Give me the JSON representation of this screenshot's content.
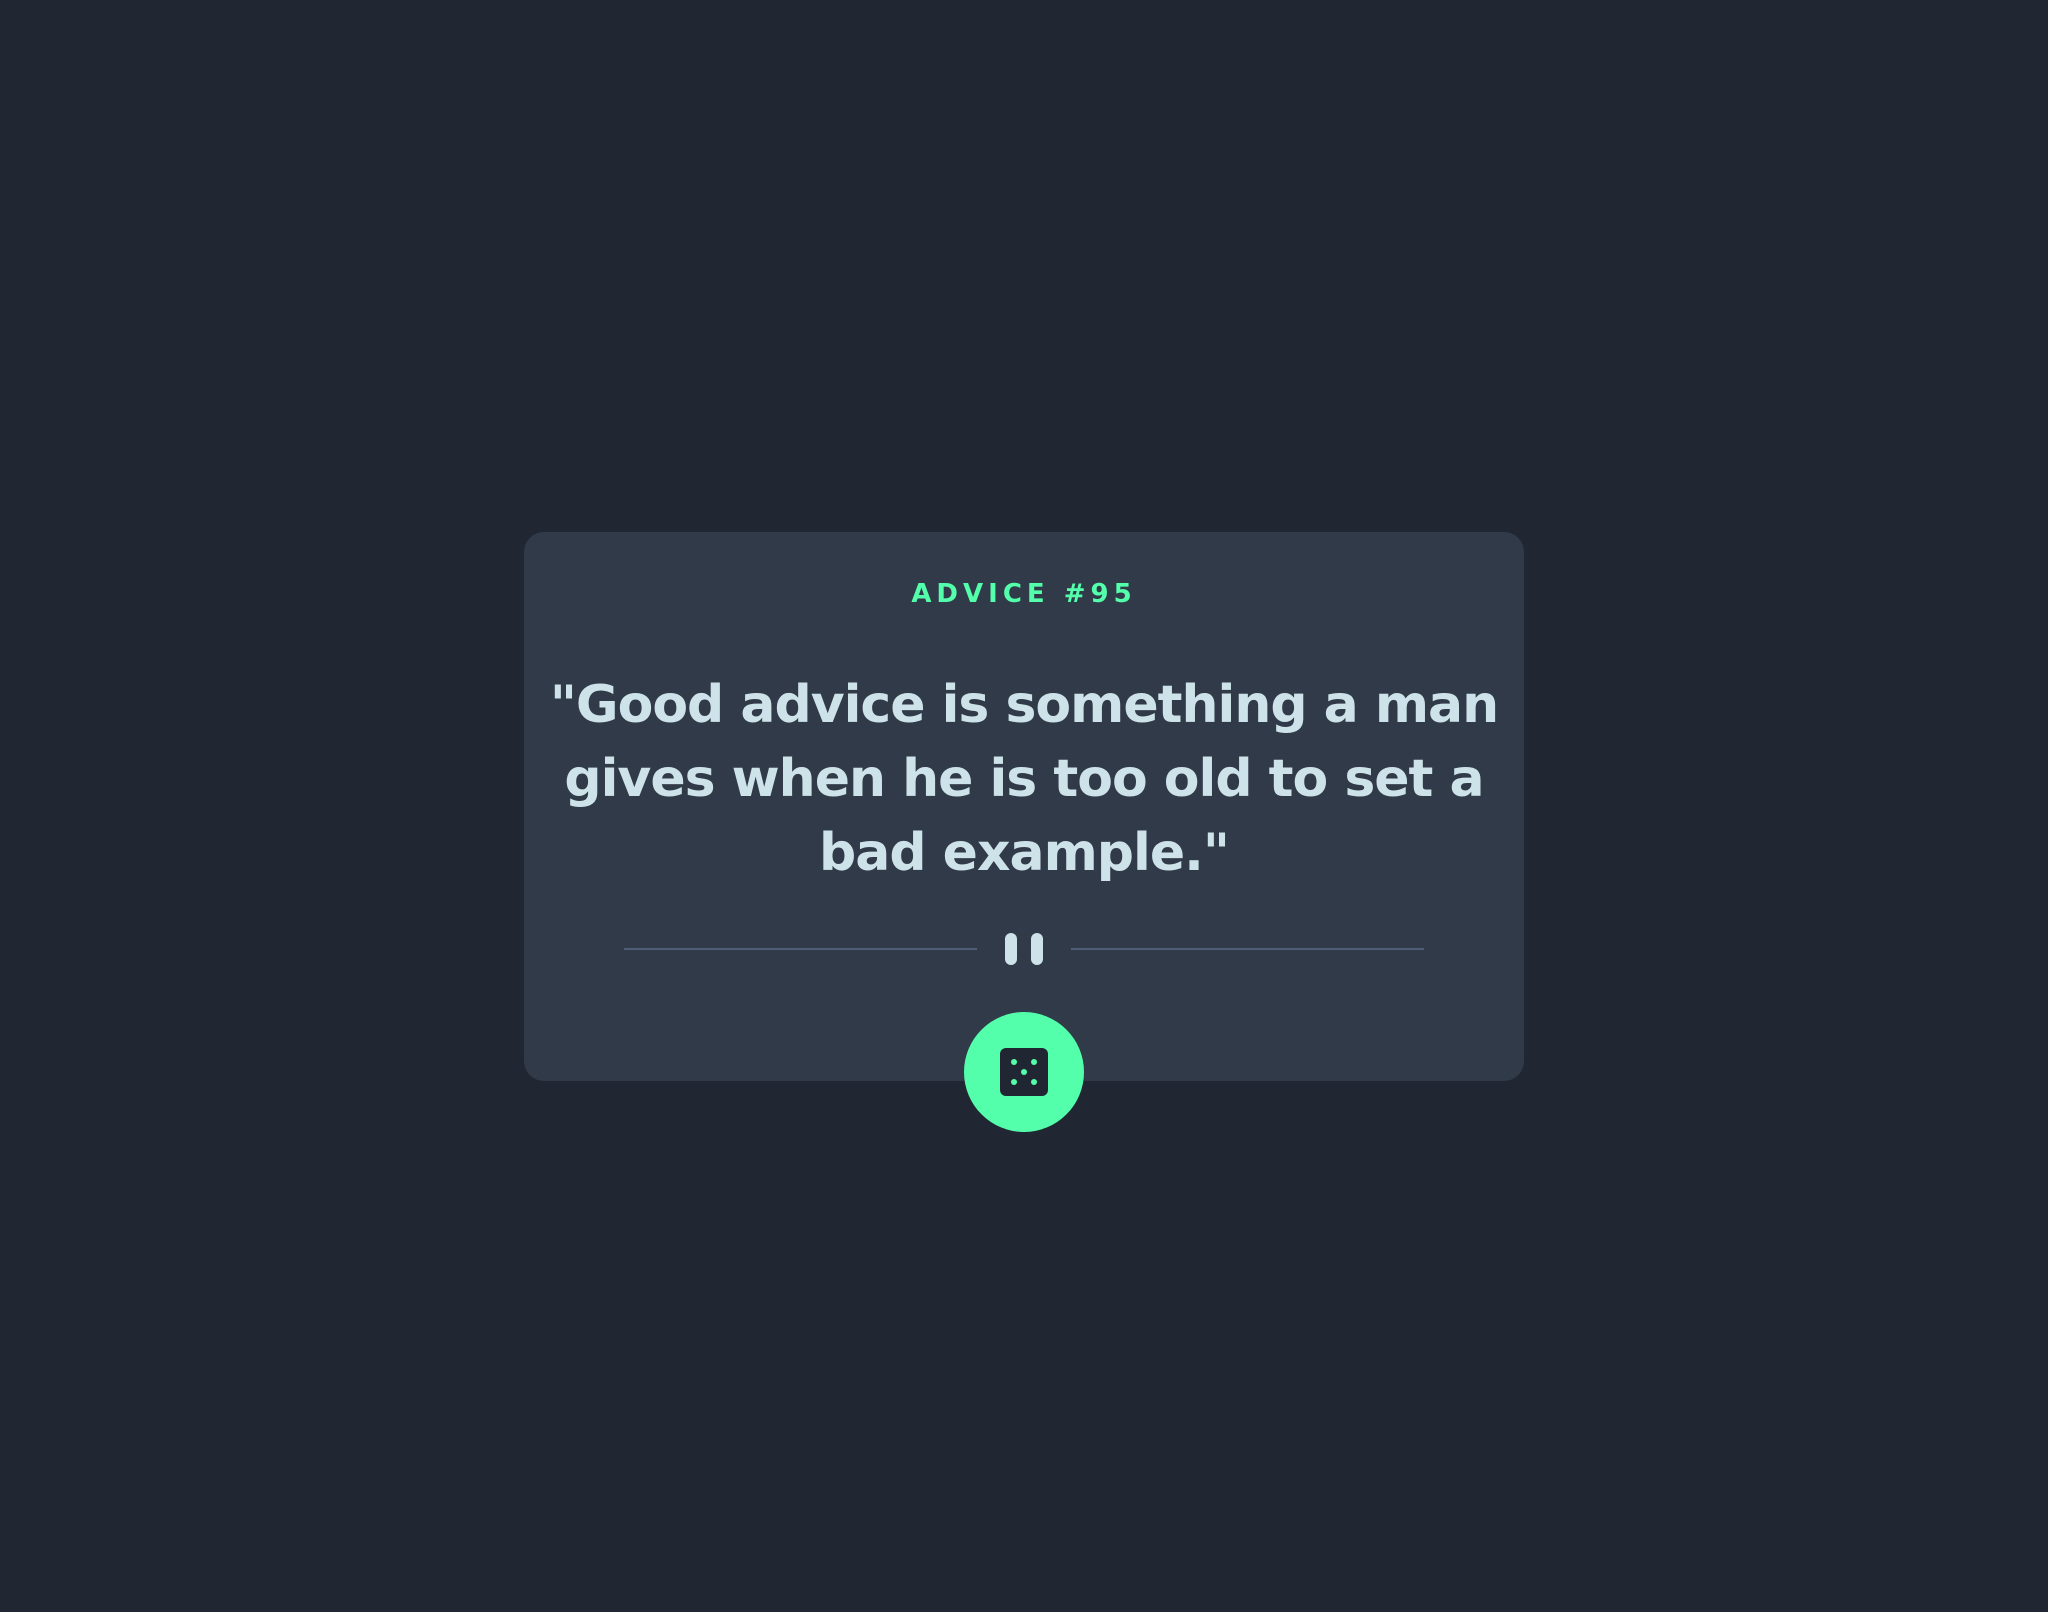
{
  "advice": {
    "number_label": "ADVICE #95",
    "text": "\"Good advice is something a man gives when he is too old to set a bad example.\""
  },
  "icons": {
    "divider": "pause-icon",
    "button": "dice-icon"
  },
  "colors": {
    "background": "#202733",
    "card": "#313a48",
    "accent": "#53ffab",
    "text": "#cee3e9",
    "divider": "#4f5d74"
  }
}
